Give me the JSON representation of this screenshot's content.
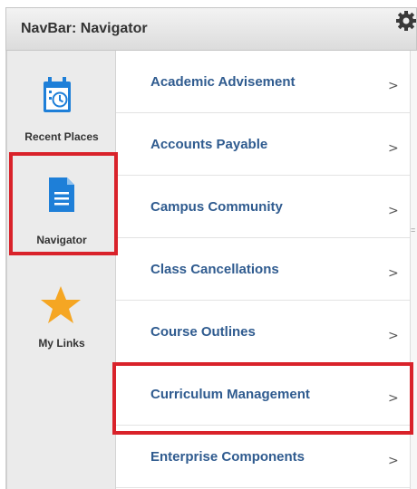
{
  "header": {
    "title": "NavBar: Navigator",
    "settings_icon": "gear-icon"
  },
  "sidebar": {
    "items": [
      {
        "label": "Recent Places",
        "icon": "calendar-clock-icon"
      },
      {
        "label": "Navigator",
        "icon": "document-icon"
      },
      {
        "label": "My Links",
        "icon": "star-icon"
      }
    ]
  },
  "menu": {
    "items": [
      {
        "label": "Academic Advisement"
      },
      {
        "label": "Accounts Payable"
      },
      {
        "label": "Campus Community"
      },
      {
        "label": "Class Cancellations"
      },
      {
        "label": "Course Outlines"
      },
      {
        "label": "Curriculum Management"
      },
      {
        "label": "Enterprise Components"
      }
    ],
    "chevron": ">"
  },
  "colors": {
    "link": "#2f5b8f",
    "highlight": "#d9222a",
    "icon_blue": "#1e7fd8",
    "star": "#f5a623"
  }
}
